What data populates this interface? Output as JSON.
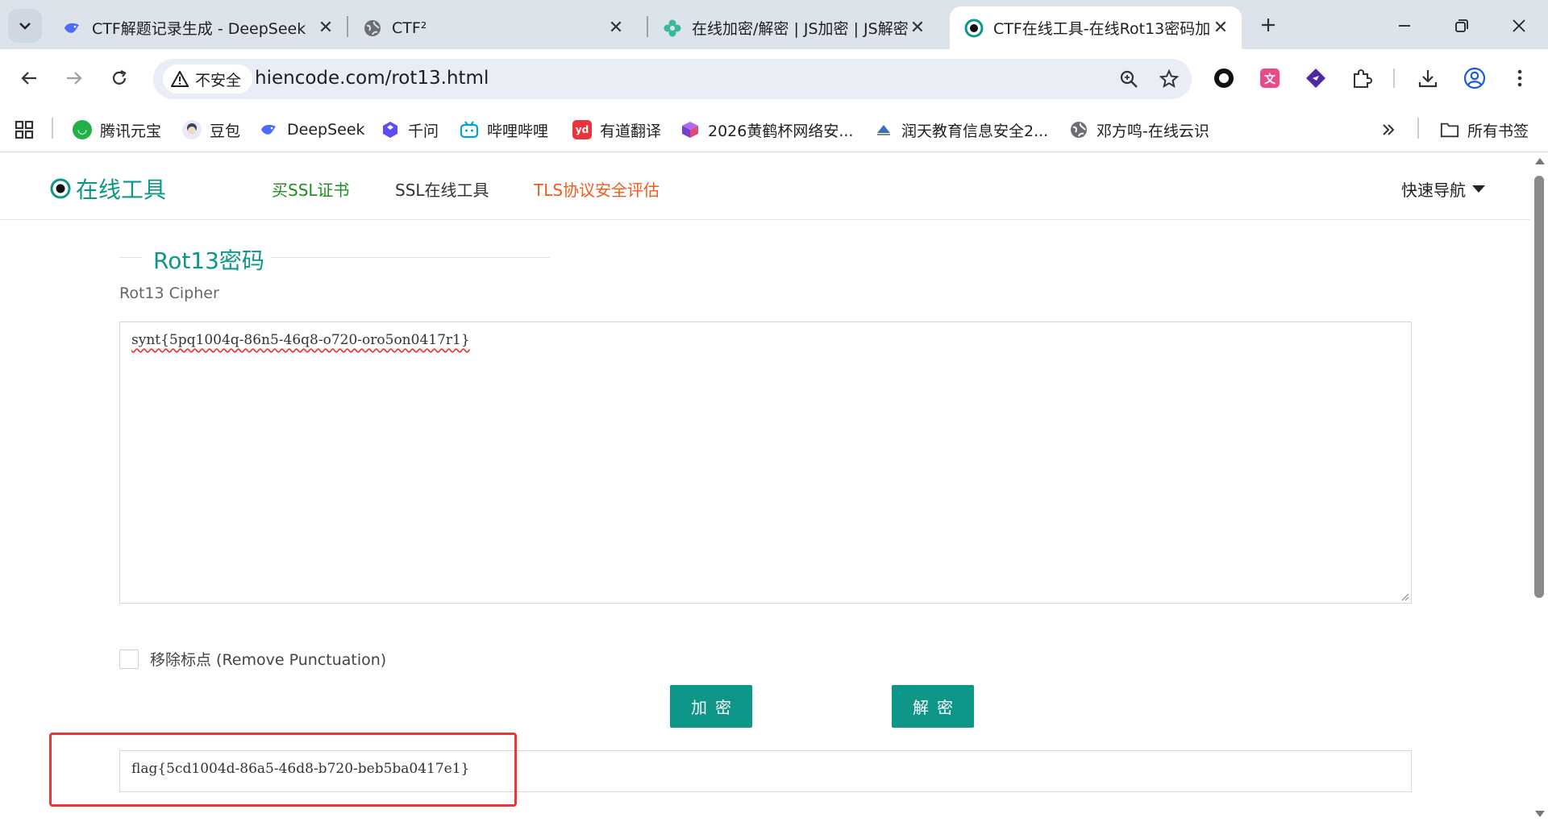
{
  "browser": {
    "tabs": [
      {
        "title": "CTF解题记录生成 - DeepSeek",
        "icon": "deepseek-whale-icon",
        "active": false
      },
      {
        "title": "CTF²",
        "icon": "globe-icon",
        "active": false
      },
      {
        "title": "在线加密/解密 | JS加密 | JS解密",
        "icon": "flower-icon",
        "active": false
      },
      {
        "title": "CTF在线工具-在线Rot13密码加",
        "icon": "hiencode-logo-icon",
        "active": true
      }
    ],
    "address": {
      "security_label": "不安全",
      "url": "hiencode.com/rot13.html"
    },
    "bookmarks": [
      {
        "label": "腾讯元宝",
        "icon": "yuanbao-icon",
        "color": "#22b04a"
      },
      {
        "label": "豆包",
        "icon": "doubao-icon",
        "color": "#6b7fcf"
      },
      {
        "label": "DeepSeek",
        "icon": "deepseek-whale-icon",
        "color": "#4d6bfe"
      },
      {
        "label": "千问",
        "icon": "qianwen-icon",
        "color": "#5b4cf5"
      },
      {
        "label": "哔哩哔哩",
        "icon": "bilibili-icon",
        "color": "#00a1d6"
      },
      {
        "label": "有道翻译",
        "icon": "youdao-icon",
        "color": "#e8343b"
      },
      {
        "label": "2026黄鹤杯网络安...",
        "icon": "cube-icon",
        "color": "#7b3fd0"
      },
      {
        "label": "润天教育信息安全2...",
        "icon": "runtian-icon",
        "color": "#3a6fb5"
      },
      {
        "label": "邓方鸣-在线云识",
        "icon": "globe-icon",
        "color": "#555555"
      }
    ],
    "all_bookmarks_label": "所有书签"
  },
  "site": {
    "logo_text": "在线工具",
    "nav": [
      {
        "label": "买SSL证书",
        "color": "#1e8e1e"
      },
      {
        "label": "SSL在线工具",
        "color": "#333333"
      },
      {
        "label": "TLS协议安全评估",
        "color": "#f05a1a"
      }
    ],
    "quick_nav": "快速导航"
  },
  "tool": {
    "title": "Rot13密码",
    "subtitle": "Rot13 Cipher",
    "input_value": "synt{5pq1004q-86n5-46q8-o720-oro5on0417r1}",
    "remove_punctuation_label": "移除标点 (Remove Punctuation)",
    "remove_punctuation_checked": false,
    "encrypt_label": "加密",
    "decrypt_label": "解密",
    "output_value": "flag{5cd1004d-86a5-46d8-b720-beb5ba0417e1}"
  },
  "colors": {
    "accent": "#0e9688",
    "highlight": "#e53935"
  }
}
